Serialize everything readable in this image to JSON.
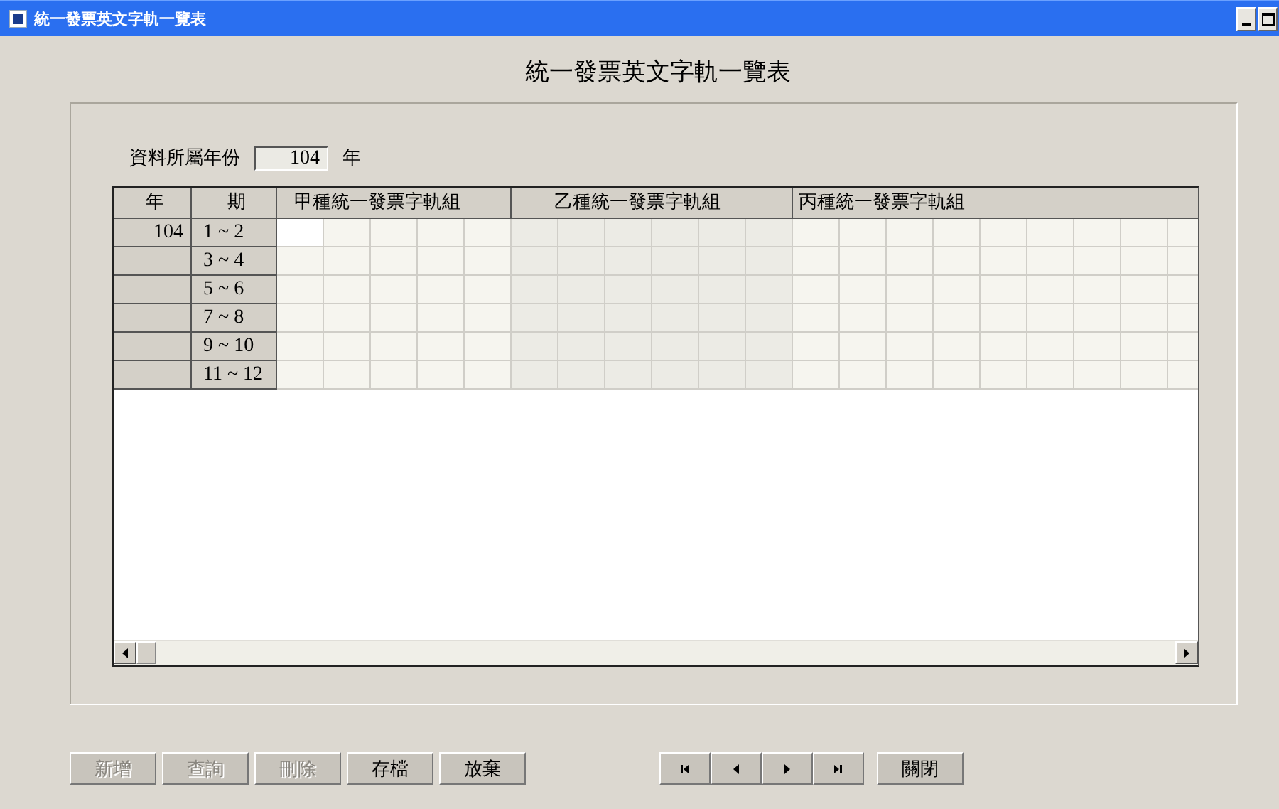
{
  "window": {
    "title": "統一發票英文字軌一覽表"
  },
  "form_title": "統一發票英文字軌一覽表",
  "year_field": {
    "label": "資料所屬年份",
    "value": "104",
    "unit": "年"
  },
  "grid": {
    "columns": [
      {
        "label": "年",
        "kind": "fixed"
      },
      {
        "label": "期",
        "kind": "fixed"
      },
      {
        "label": "甲種統一發票字軌組",
        "kind": "group"
      },
      {
        "label": "乙種統一發票字軌組",
        "kind": "group"
      },
      {
        "label": "丙種統一發票字軌組",
        "kind": "group"
      }
    ],
    "rows": [
      {
        "year": "104",
        "period": "1 ~ 2"
      },
      {
        "period": "3 ~ 4"
      },
      {
        "period": "5 ~ 6"
      },
      {
        "period": "7 ~ 8"
      },
      {
        "period": "9 ~ 10"
      },
      {
        "period": "11 ~ 12"
      }
    ]
  },
  "buttons": [
    {
      "label": "新增",
      "disabled": true
    },
    {
      "label": "查詢",
      "disabled": true
    },
    {
      "label": "刪除",
      "disabled": true
    },
    {
      "label": "存檔",
      "disabled": false
    },
    {
      "label": "放棄",
      "disabled": false
    }
  ],
  "nav_buttons": [
    {
      "kind": "first"
    },
    {
      "kind": "prev"
    },
    {
      "kind": "next"
    },
    {
      "kind": "last"
    }
  ],
  "close_button": {
    "label": "關閉"
  }
}
